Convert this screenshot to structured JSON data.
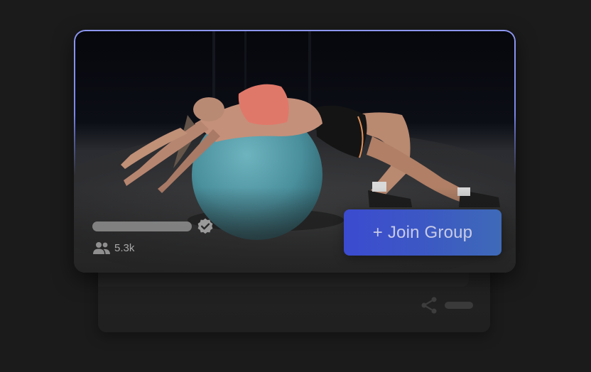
{
  "card": {
    "members_count": "5.3k",
    "join_button_label": "+ Join Group",
    "verified": true
  },
  "icons": {
    "verified": "verified-badge-icon",
    "members": "people-icon",
    "share": "share-icon"
  },
  "colors": {
    "page_background": "#1b1b1b",
    "card_border": "#8d97f2",
    "button_start": "#3b4bd0",
    "button_end": "#3e6ab8",
    "button_text": "#c8cbe6"
  }
}
